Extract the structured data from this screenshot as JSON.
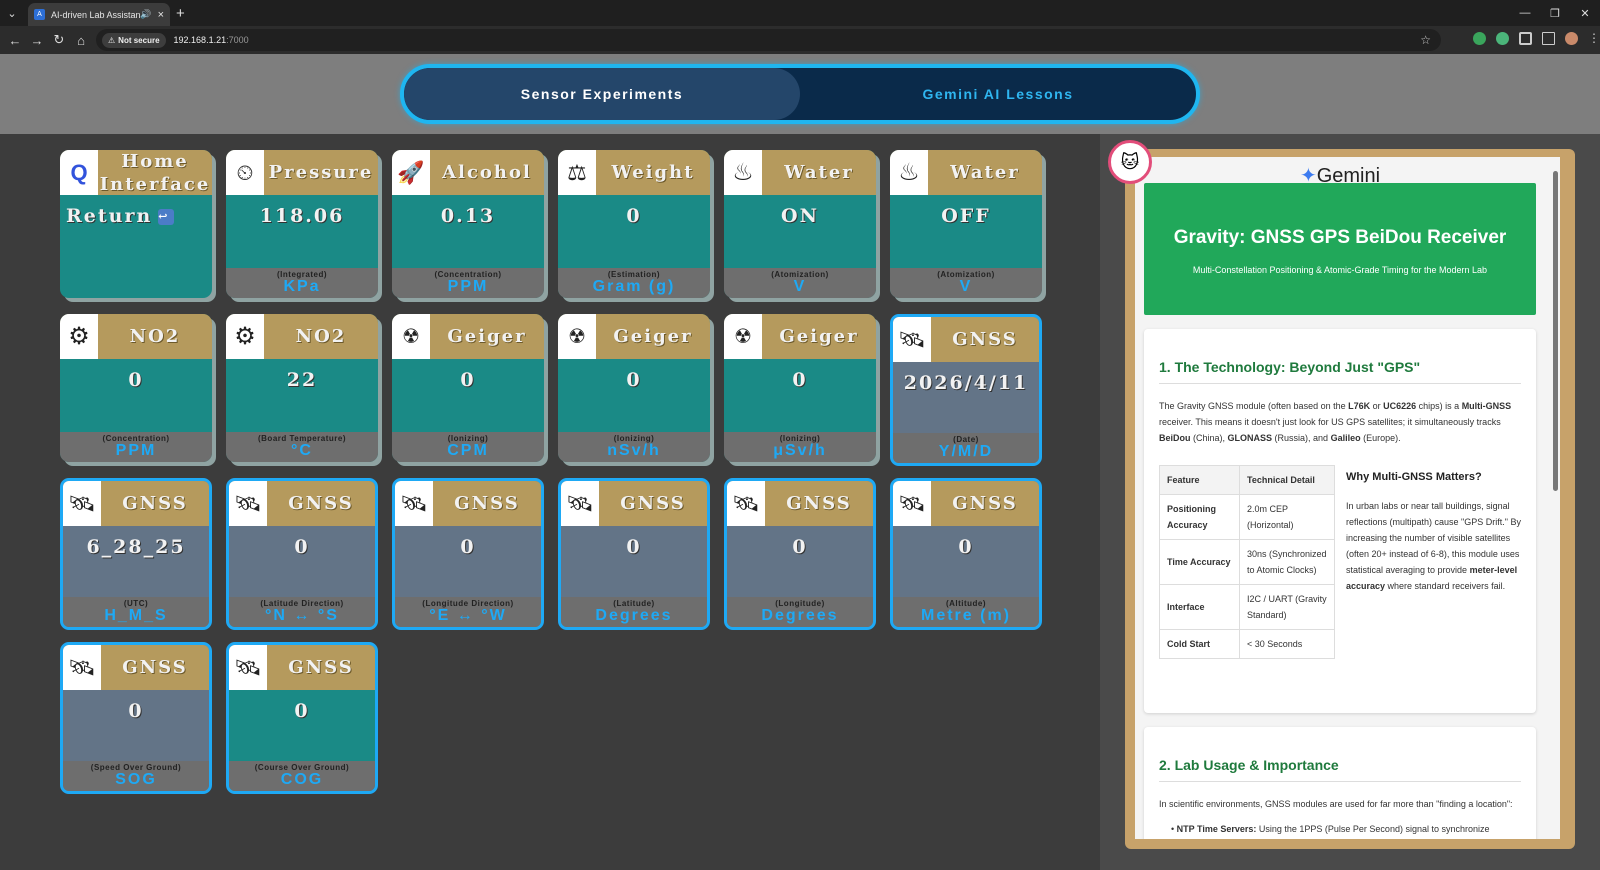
{
  "browser": {
    "tab_title": "AI-driven Lab Assistant",
    "not_secure": "Not secure",
    "url_host": "192.168.1.21",
    "url_port": ":7000"
  },
  "toggle": {
    "active": "Sensor Experiments",
    "inactive": "Gemini AI Lessons"
  },
  "cards": [
    {
      "title": "Home Interface",
      "value": "Return",
      "sub": "",
      "unit": "",
      "icon": "qualcomm-logo-icon"
    },
    {
      "title": "Pressure",
      "value": "118.06",
      "sub": "(Integrated)",
      "unit": "KPa",
      "icon": "pressure-gauge-icon"
    },
    {
      "title": "Alcohol",
      "value": "0.13",
      "sub": "(Concentration)",
      "unit": "PPM",
      "icon": "alcohol-sensor-icon"
    },
    {
      "title": "Weight",
      "value": "0",
      "sub": "(Estimation)",
      "unit": "Gram (g)",
      "icon": "scale-icon"
    },
    {
      "title": "Water",
      "value": "ON",
      "sub": "(Atomization)",
      "unit": "V",
      "icon": "steam-icon"
    },
    {
      "title": "Water",
      "value": "OFF",
      "sub": "(Atomization)",
      "unit": "V",
      "icon": "steam-icon"
    },
    {
      "title": "NO2",
      "value": "0",
      "sub": "(Concentration)",
      "unit": "PPM",
      "icon": "no2-gear-icon"
    },
    {
      "title": "NO2",
      "value": "22",
      "sub": "(Board Temperature)",
      "unit": "°C",
      "icon": "no2-gear-icon"
    },
    {
      "title": "Geiger",
      "value": "0",
      "sub": "(Ionizing)",
      "unit": "CPM",
      "icon": "geiger-counter-icon"
    },
    {
      "title": "Geiger",
      "value": "0",
      "sub": "(Ionizing)",
      "unit": "nSv/h",
      "icon": "geiger-counter-icon"
    },
    {
      "title": "Geiger",
      "value": "0",
      "sub": "(Ionizing)",
      "unit": "μSv/h",
      "icon": "geiger-counter-icon"
    },
    {
      "title": "GNSS",
      "value": "2026/4/11",
      "sub": "(Date)",
      "unit": "Y/M/D",
      "icon": "satellite-icon"
    },
    {
      "title": "GNSS",
      "value": "6_28_25",
      "sub": "(UTC)",
      "unit": "H_M_S",
      "icon": "satellite-icon"
    },
    {
      "title": "GNSS",
      "value": "0",
      "sub": "(Latitude Direction)",
      "unit": "°N ↔ °S",
      "icon": "satellite-icon"
    },
    {
      "title": "GNSS",
      "value": "0",
      "sub": "(Longitude Direction)",
      "unit": "°E ↔ °W",
      "icon": "satellite-icon"
    },
    {
      "title": "GNSS",
      "value": "0",
      "sub": "(Latitude)",
      "unit": "Degrees",
      "icon": "satellite-icon"
    },
    {
      "title": "GNSS",
      "value": "0",
      "sub": "(Longitude)",
      "unit": "Degrees",
      "icon": "satellite-icon"
    },
    {
      "title": "GNSS",
      "value": "0",
      "sub": "(Altitude)",
      "unit": "Metre (m)",
      "icon": "satellite-icon"
    },
    {
      "title": "GNSS",
      "value": "0",
      "sub": "(Speed Over Ground)",
      "unit": "SOG",
      "icon": "satellite-icon"
    },
    {
      "title": "GNSS",
      "value": "0",
      "sub": "(Course Over Ground)",
      "unit": "COG",
      "icon": "satellite-icon"
    }
  ],
  "lesson": {
    "brand": "Gemini",
    "title": "Gravity: GNSS GPS BeiDou Receiver",
    "subtitle": "Multi-Constellation Positioning & Atomic-Grade Timing for the Modern Lab",
    "s1_heading": "1. The Technology: Beyond Just \"GPS\"",
    "s1_p1": "The Gravity GNSS module (often based on the ",
    "s1_b1": "L76K",
    "s1_p2": " or ",
    "s1_b2": "UC6226",
    "s1_p3": " chips) is a ",
    "s1_b3": "Multi-GNSS",
    "s1_p4": " receiver. This means it doesn't just look for US GPS satellites; it simultaneously tracks ",
    "s1_b4": "BeiDou",
    "s1_p5": " (China), ",
    "s1_b5": "GLONASS",
    "s1_p6": " (Russia), and ",
    "s1_b6": "Galileo",
    "s1_p7": " (Europe).",
    "table_header": [
      "Feature",
      "Technical Detail"
    ],
    "table_rows": [
      [
        "Positioning Accuracy",
        "2.0m CEP (Horizontal)"
      ],
      [
        "Time Accuracy",
        "30ns (Synchronized to Atomic Clocks)"
      ],
      [
        "Interface",
        "I2C / UART (Gravity Standard)"
      ],
      [
        "Cold Start",
        "< 30 Seconds"
      ]
    ],
    "why_heading": "Why Multi-GNSS Matters?",
    "why_text": "In urban labs or near tall buildings, signal reflections (multipath) cause \"GPS Drift.\" By increasing the number of visible satellites (often 20+ instead of 6-8), this module uses statistical averaging to provide ",
    "why_bold": "meter-level accuracy",
    "why_text2": " where standard receivers fail.",
    "s2_heading": "2. Lab Usage & Importance",
    "s2_p": "In scientific environments, GNSS modules are used for far more than \"finding a location\":",
    "s2_bullet_bold": "NTP Time Servers:",
    "s2_bullet": " Using the 1PPS (Pulse Per Second) signal to synchronize"
  }
}
